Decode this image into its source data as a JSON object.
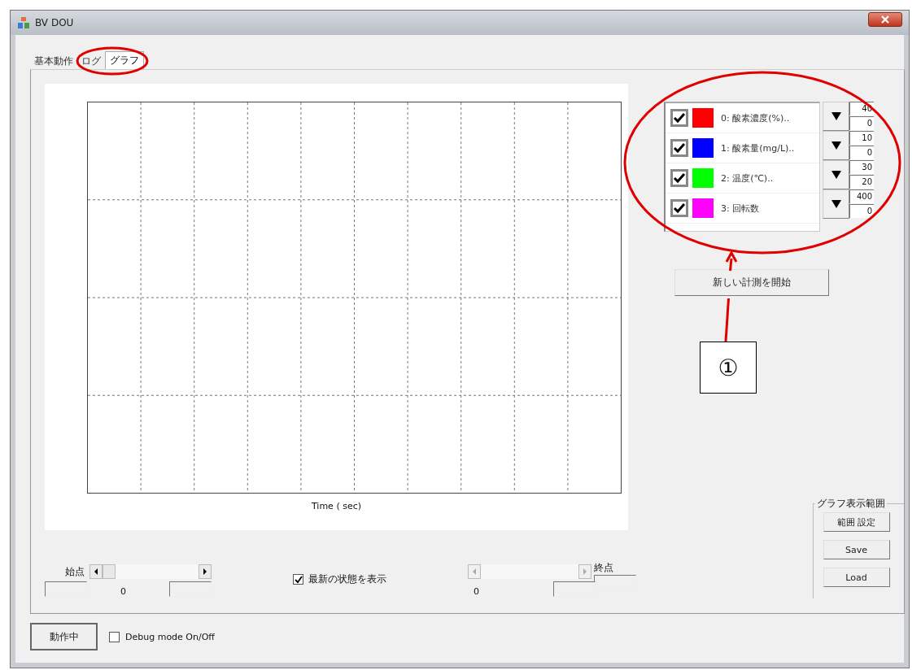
{
  "window": {
    "title": "BV DOU"
  },
  "tabs": [
    {
      "label": "基本動作",
      "selected": false
    },
    {
      "label": "ログ",
      "selected": false
    },
    {
      "label": "グラフ",
      "selected": true
    }
  ],
  "plot": {
    "xlabel": "Time ( sec)"
  },
  "series": [
    {
      "label": "0: 酸素濃度(%)..",
      "color": "#ff0000",
      "visible": true,
      "max": "40",
      "min": "0"
    },
    {
      "label": "1: 酸素量(mg/L)..",
      "color": "#0000ff",
      "visible": true,
      "max": "10",
      "min": "0"
    },
    {
      "label": "2: 温度(℃)..",
      "color": "#00ff00",
      "visible": true,
      "max": "30",
      "min": "20"
    },
    {
      "label": "3: 回転数",
      "color": "#ff00ff",
      "visible": true,
      "max": "400",
      "min": "0"
    }
  ],
  "start_button": "新しい計測を開始",
  "start_range": {
    "label": "始点",
    "value": "0",
    "disabled": false
  },
  "show_latest": {
    "label": "最新の状態を表示",
    "checked": true
  },
  "end_range": {
    "label": "終点",
    "value": "0",
    "disabled": true
  },
  "range_group": {
    "title": "グラフ表示範囲",
    "buttons": [
      "範囲 設定",
      "Save",
      "Load"
    ]
  },
  "status_button": "動作中",
  "debug": {
    "label": "Debug mode On/Off",
    "checked": false
  },
  "callout": "①"
}
